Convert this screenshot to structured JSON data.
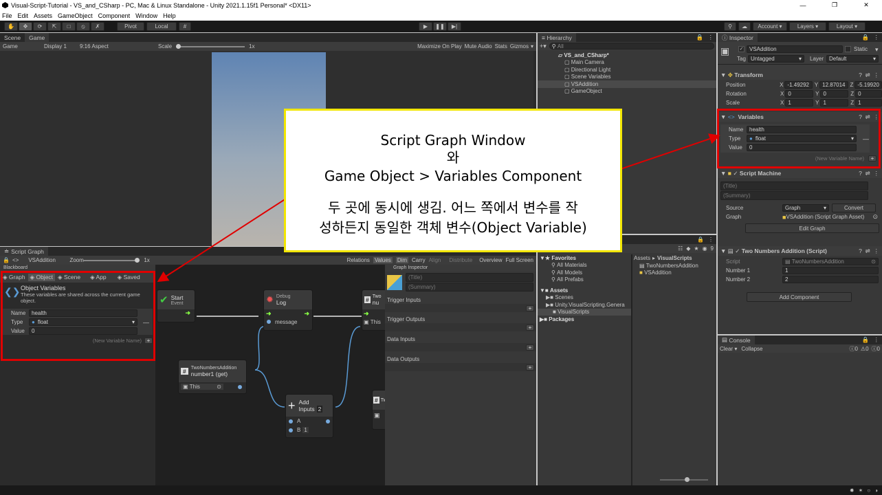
{
  "window_title": "Visual-Script-Tutorial - VS_and_CSharp - PC, Mac & Linux Standalone - Unity 2021.1.15f1 Personal* <DX11>",
  "menu": [
    "File",
    "Edit",
    "Assets",
    "GameObject",
    "Component",
    "Window",
    "Help"
  ],
  "toolbar": {
    "pivot": "Pivot",
    "local": "Local",
    "account": "Account",
    "layers": "Layers",
    "layout": "Layout"
  },
  "game_view": {
    "tabs": [
      "Scene",
      "Game"
    ],
    "display_mode": "Game",
    "display": "Display 1",
    "aspect": "9:16 Aspect",
    "scale_label": "Scale",
    "scale_value": "1x",
    "options": [
      "Maximize On Play",
      "Mute Audio",
      "Stats",
      "Gizmos"
    ]
  },
  "hierarchy": {
    "tab": "Hierarchy",
    "search_placeholder": "All",
    "scene": "VS_and_CSharp*",
    "items": [
      "Main Camera",
      "Directional Light",
      "Scene Variables",
      "VSAddition",
      "GameObject"
    ]
  },
  "inspector": {
    "tab": "Inspector",
    "object_name": "VSAddition",
    "static_label": "Static",
    "tag_label": "Tag",
    "tag_value": "Untagged",
    "layer_label": "Layer",
    "layer_value": "Default",
    "transform": {
      "title": "Transform",
      "position_label": "Position",
      "position": [
        "-1.49292",
        "12.87014",
        "-5.19920"
      ],
      "rotation_label": "Rotation",
      "rotation": [
        "0",
        "0",
        "0"
      ],
      "scale_label": "Scale",
      "scale": [
        "1",
        "1",
        "1"
      ]
    },
    "variables": {
      "title": "Variables",
      "name_label": "Name",
      "name": "health",
      "type_label": "Type",
      "type": "float",
      "value_label": "Value",
      "value": "0",
      "new_placeholder": "(New Variable Name)"
    },
    "script_machine": {
      "title": "Script Machine",
      "title_placeholder": "(Title)",
      "summary_placeholder": "(Summary)",
      "source_label": "Source",
      "source_value": "Graph",
      "convert": "Convert",
      "graph_label": "Graph",
      "graph_value": "VSAddition (Script Graph Asset)",
      "edit_graph": "Edit Graph"
    },
    "script_component": {
      "title": "Two Numbers Addition (Script)",
      "script_label": "Script",
      "script_value": "TwoNumbersAddition",
      "number1_label": "Number 1",
      "number1": "1",
      "number2_label": "Number 2",
      "number2": "2"
    },
    "add_component": "Add Component"
  },
  "script_graph": {
    "tab": "Script Graph",
    "breadcrumb": "VSAddition",
    "zoom_label": "Zoom",
    "zoom_value": "1x",
    "tools": [
      "Relations",
      "Values",
      "Dim",
      "Carry",
      "Align",
      "Distribute",
      "Overview",
      "Full Screen"
    ],
    "blackboard": {
      "title": "Blackboard",
      "tabs": [
        "Graph",
        "Object",
        "Scene",
        "App",
        "Saved"
      ],
      "section_title": "Object Variables",
      "section_desc": "These variables are shared across the current game object.",
      "name_label": "Name",
      "name": "health",
      "type_label": "Type",
      "type": "float",
      "value_label": "Value",
      "value": "0",
      "new_placeholder": "(New Variable Name)"
    },
    "nodes": {
      "start": {
        "title": "Start",
        "sub": "Event"
      },
      "debug": {
        "title": "Debug",
        "sub": "Log",
        "port": "message"
      },
      "get": {
        "title": "TwoNumbersAddition",
        "sub": "number1 (get)",
        "field": "This"
      },
      "add": {
        "title": "Add",
        "sub": "Inputs",
        "inputs_count": "2",
        "a": "A",
        "b": "B",
        "b_value": "1"
      },
      "partial1": {
        "title": "Two",
        "sub": "nu",
        "field": "This"
      },
      "partial2": {
        "title": "Tw"
      }
    },
    "graph_inspector": {
      "title": "Graph Inspector",
      "title_placeholder": "(Title)",
      "summary_placeholder": "(Summary)",
      "sections": [
        "Trigger Inputs",
        "Trigger Outputs",
        "Data Inputs",
        "Data Outputs"
      ]
    }
  },
  "project": {
    "favorites": {
      "label": "Favorites",
      "items": [
        "All Materials",
        "All Models",
        "All Prefabs"
      ]
    },
    "assets": {
      "label": "Assets",
      "items": [
        "Scenes",
        "Unity.VisualScripting.Genera",
        "VisualScripts"
      ]
    },
    "packages": "Packages",
    "breadcrumb": [
      "Assets",
      "VisualScripts"
    ],
    "files": [
      "TwoNumbersAddition",
      "VSAddition"
    ],
    "count": "9"
  },
  "console": {
    "tab": "Console",
    "clear": "Clear",
    "collapse": "Collapse",
    "errors": "0",
    "warnings": "0",
    "logs": "0"
  },
  "annotation": {
    "line1": "Script Graph Window",
    "line2": "와",
    "line3": "Game Object > Variables Component",
    "line4": "두 곳에 동시에 생김. 어느 쪽에서 변수를 작",
    "line5": "성하든지 동일한 객체 변수(Object Variable)"
  },
  "colors": {
    "highlight_red": "#e00000",
    "callout_yellow": "#f2e600",
    "sky_top": "#5f84b3",
    "sky_bottom": "#b9b4ad"
  }
}
